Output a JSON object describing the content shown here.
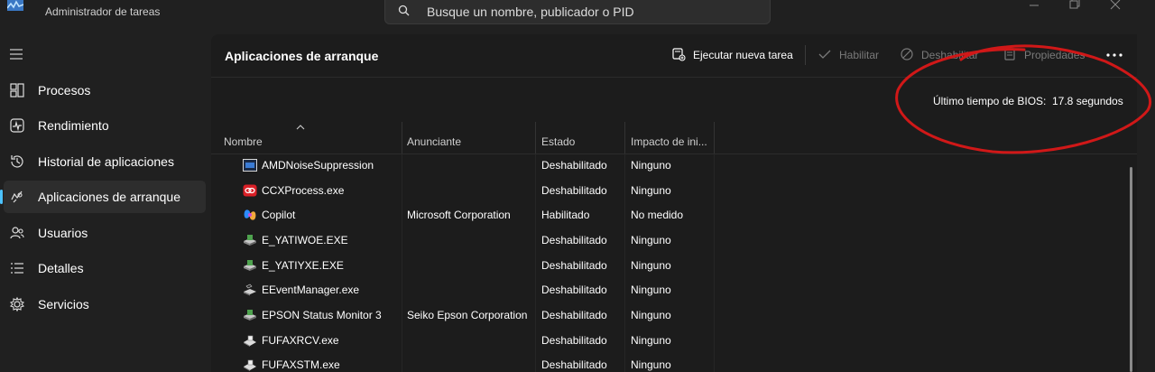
{
  "window": {
    "title": "Administrador de tareas",
    "search_placeholder": "Busque un nombre, publicador o PID"
  },
  "nav": {
    "items": [
      {
        "label": "Procesos",
        "icon": "processes-icon"
      },
      {
        "label": "Rendimiento",
        "icon": "performance-icon"
      },
      {
        "label": "Historial de aplicaciones",
        "icon": "history-icon"
      },
      {
        "label": "Aplicaciones de arranque",
        "icon": "startup-icon",
        "selected": true
      },
      {
        "label": "Usuarios",
        "icon": "users-icon"
      },
      {
        "label": "Detalles",
        "icon": "details-icon"
      },
      {
        "label": "Servicios",
        "icon": "services-icon"
      }
    ]
  },
  "main": {
    "title": "Aplicaciones de arranque",
    "toolbar": {
      "run_new_task": "Ejecutar nueva tarea",
      "enable": "Habilitar",
      "disable": "Deshabilitar",
      "properties": "Propiedades"
    },
    "bios": {
      "label": "Último tiempo de BIOS:",
      "value": "17.8 segundos"
    }
  },
  "table": {
    "columns": [
      "Nombre",
      "Anunciante",
      "Estado",
      "Impacto de ini..."
    ],
    "rows": [
      {
        "name": "AMDNoiseSuppression",
        "publisher": "",
        "status": "Deshabilitado",
        "impact": "Ninguno",
        "icon": "amd-app-icon"
      },
      {
        "name": "CCXProcess.exe",
        "publisher": "",
        "status": "Deshabilitado",
        "impact": "Ninguno",
        "icon": "adobe-cc-icon"
      },
      {
        "name": "Copilot",
        "publisher": "Microsoft Corporation",
        "status": "Habilitado",
        "impact": "No medido",
        "icon": "copilot-icon"
      },
      {
        "name": "E_YATIWOE.EXE",
        "publisher": "",
        "status": "Deshabilitado",
        "impact": "Ninguno",
        "icon": "epson-printer-icon"
      },
      {
        "name": "E_YATIYXE.EXE",
        "publisher": "",
        "status": "Deshabilitado",
        "impact": "Ninguno",
        "icon": "epson-printer-icon"
      },
      {
        "name": "EEventManager.exe",
        "publisher": "",
        "status": "Deshabilitado",
        "impact": "Ninguno",
        "icon": "scanner-icon"
      },
      {
        "name": "EPSON Status Monitor 3",
        "publisher": "Seiko Epson Corporation",
        "status": "Deshabilitado",
        "impact": "Ninguno",
        "icon": "epson-printer-icon"
      },
      {
        "name": "FUFAXRCV.exe",
        "publisher": "",
        "status": "Deshabilitado",
        "impact": "Ninguno",
        "icon": "fax-icon"
      },
      {
        "name": "FUFAXSTM.exe",
        "publisher": "",
        "status": "Deshabilitado",
        "impact": "Ninguno",
        "icon": "fax-icon"
      }
    ]
  },
  "colors": {
    "accent": "#4cc2ff",
    "annotation": "#d01818"
  }
}
